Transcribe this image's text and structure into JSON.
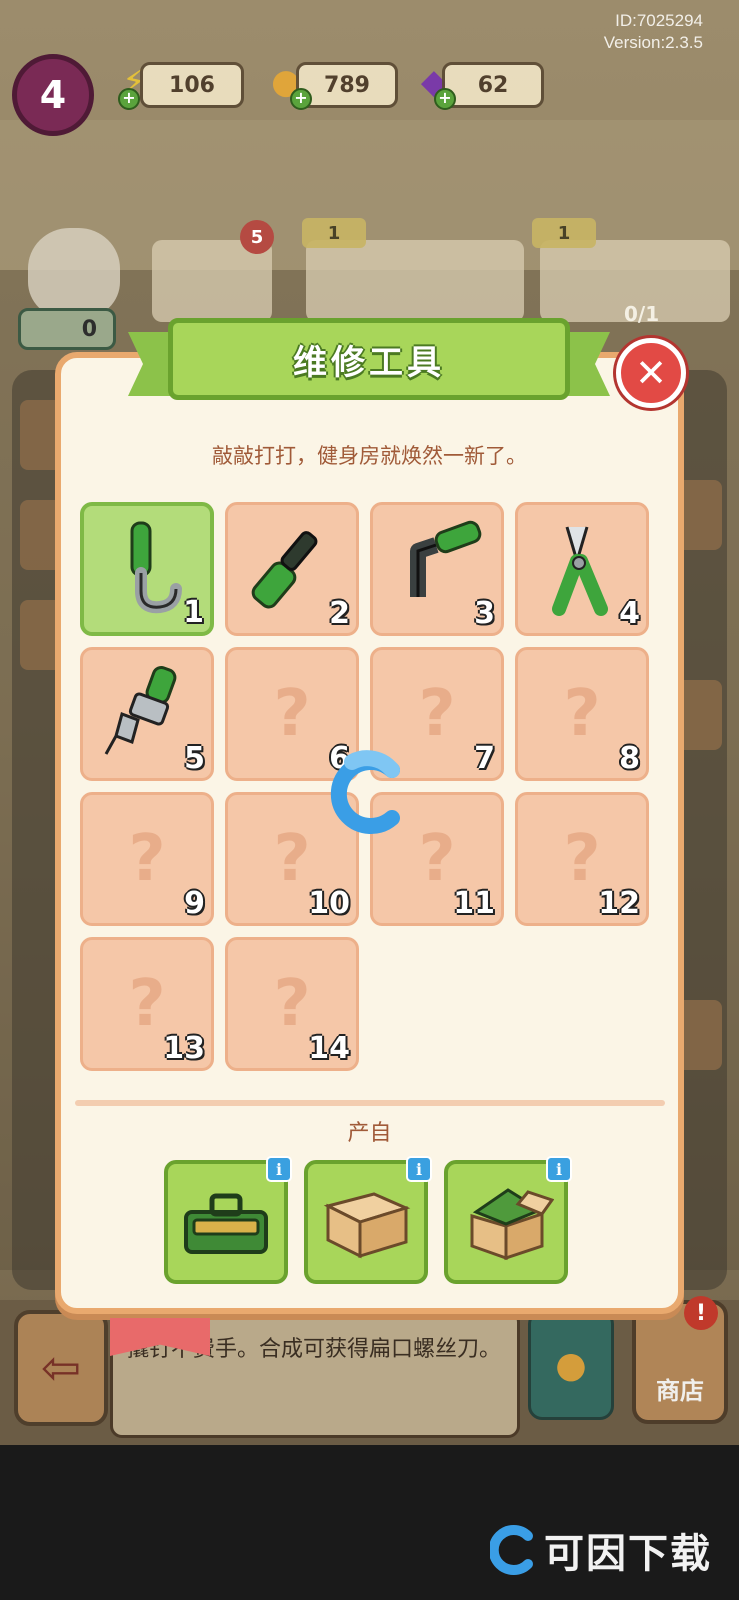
{
  "hud": {
    "id_text": "ID:7025294",
    "version_text": "Version:2.3.5",
    "level": "4",
    "energy": "106",
    "coins": "789",
    "gems": "62"
  },
  "background": {
    "collection_count": "5",
    "chip_1": "1",
    "chip_2": "1",
    "progress": "0/1",
    "star_count": "0"
  },
  "modal": {
    "title": "维修工具",
    "subtitle": "敲敲打打，健身房就焕然一新了。",
    "close_symbol": "✕",
    "slots": [
      {
        "num": "1",
        "item": "hook-tool",
        "unlocked": true,
        "selected": true
      },
      {
        "num": "2",
        "item": "screwdriver",
        "unlocked": true
      },
      {
        "num": "3",
        "item": "hex-key",
        "unlocked": true
      },
      {
        "num": "4",
        "item": "pliers",
        "unlocked": true
      },
      {
        "num": "5",
        "item": "adjustable-wrench",
        "unlocked": true
      },
      {
        "num": "6",
        "unlocked": false
      },
      {
        "num": "7",
        "unlocked": false
      },
      {
        "num": "8",
        "unlocked": false
      },
      {
        "num": "9",
        "unlocked": false
      },
      {
        "num": "10",
        "unlocked": false
      },
      {
        "num": "11",
        "unlocked": false
      },
      {
        "num": "12",
        "unlocked": false
      },
      {
        "num": "13",
        "unlocked": false
      },
      {
        "num": "14",
        "unlocked": false
      }
    ],
    "locked_symbol": "?",
    "origin_label": "产自",
    "origins": [
      "toolbox",
      "cardboard-box",
      "open-box"
    ],
    "info_symbol": "i"
  },
  "bottom": {
    "description": "撬钉不费手。合成可获得扁口螺丝刀。",
    "shop_label": "商店",
    "alert_symbol": "!"
  },
  "watermark": {
    "text": "可因下载"
  }
}
